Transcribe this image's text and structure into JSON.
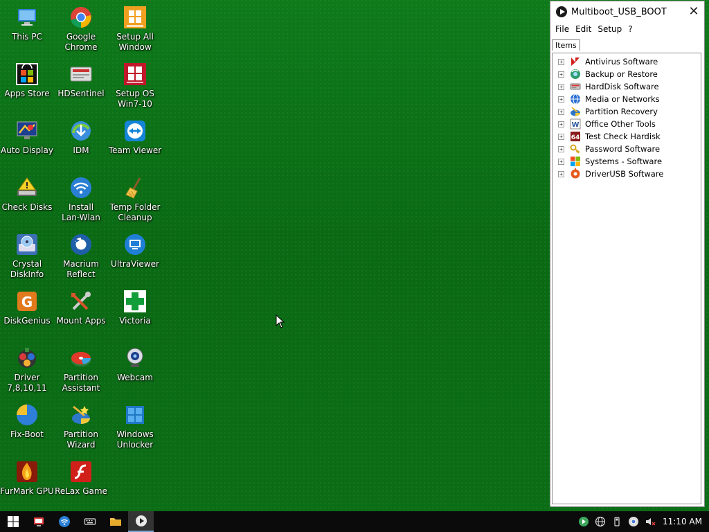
{
  "desktop": {
    "icons": [
      {
        "label": "This PC",
        "icon": "this-pc-icon"
      },
      {
        "label": "Google\nChrome",
        "icon": "chrome-icon"
      },
      {
        "label": "Setup All\nWindow",
        "icon": "setup-all-window-icon"
      },
      {
        "label": "Apps Store",
        "icon": "apps-store-icon"
      },
      {
        "label": "HDSentinel",
        "icon": "hdsentinel-icon"
      },
      {
        "label": "Setup OS\nWin7-10",
        "icon": "setup-os-icon"
      },
      {
        "label": "Auto Display",
        "icon": "auto-display-icon"
      },
      {
        "label": "IDM",
        "icon": "idm-icon"
      },
      {
        "label": "Team Viewer",
        "icon": "teamviewer-icon"
      },
      {
        "label": "Check Disks",
        "icon": "check-disks-icon"
      },
      {
        "label": "Install\nLan-Wlan",
        "icon": "wifi-icon"
      },
      {
        "label": "Temp Folder\nCleanup",
        "icon": "broom-icon"
      },
      {
        "label": "Crystal\nDiskInfo",
        "icon": "crystal-diskinfo-icon"
      },
      {
        "label": "Macrium\nReflect",
        "icon": "macrium-reflect-icon"
      },
      {
        "label": "UltraViewer",
        "icon": "ultraviewer-icon"
      },
      {
        "label": "DiskGenius",
        "icon": "diskgenius-icon"
      },
      {
        "label": "Mount Apps",
        "icon": "mount-apps-icon"
      },
      {
        "label": "Victoria",
        "icon": "victoria-icon"
      },
      {
        "label": "Driver\n7,8,10,11",
        "icon": "driver-icon"
      },
      {
        "label": "Partition\nAssistant",
        "icon": "partition-assistant-icon"
      },
      {
        "label": "Webcam",
        "icon": "webcam-icon"
      },
      {
        "label": "Fix-Boot",
        "icon": "fix-boot-icon"
      },
      {
        "label": "Partition\nWizard",
        "icon": "partition-wizard-icon"
      },
      {
        "label": "Windows\nUnlocker",
        "icon": "windows-unlocker-icon"
      },
      {
        "label": "FurMark GPU",
        "icon": "furmark-icon"
      },
      {
        "label": "ReLax Game",
        "icon": "flash-game-icon"
      }
    ]
  },
  "window": {
    "title": "Multiboot_USB_BOOT",
    "close_glyph": "✕",
    "menu": [
      "File",
      "Edit",
      "Setup",
      "?"
    ],
    "tab": "Items",
    "tree": [
      {
        "label": "Antivirus Software",
        "icon": "antivirus-icon"
      },
      {
        "label": "Backup or Restore",
        "icon": "backup-icon"
      },
      {
        "label": "HardDisk Software",
        "icon": "harddisk-icon"
      },
      {
        "label": "Media or Networks",
        "icon": "network-icon"
      },
      {
        "label": "Partition Recovery",
        "icon": "partition-recovery-icon"
      },
      {
        "label": "Office Other Tools",
        "icon": "office-icon"
      },
      {
        "label": "Test Check Hardisk",
        "icon": "test-check-icon"
      },
      {
        "label": "Password Software",
        "icon": "key-icon"
      },
      {
        "label": "Systems - Software",
        "icon": "windows-icon"
      },
      {
        "label": "DriverUSB Software",
        "icon": "driver-usb-icon"
      }
    ],
    "expander": "+"
  },
  "taskbar": {
    "clock": "11:10 AM"
  },
  "colors": {
    "desktop_green": "#0b6d15",
    "taskbar": "#0b0b0b",
    "accent": "#1e88e5"
  }
}
